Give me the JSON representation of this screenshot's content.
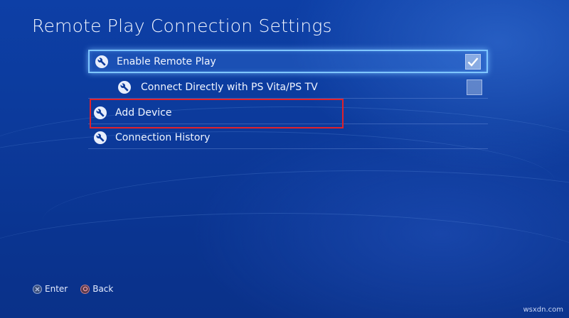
{
  "title": "Remote Play Connection Settings",
  "menu": {
    "items": [
      {
        "label": "Enable Remote Play",
        "icon": "wrench-icon",
        "checkbox": true,
        "checked": true,
        "selected": true
      },
      {
        "label": "Connect Directly with PS Vita/PS TV",
        "icon": "wrench-icon",
        "checkbox": true,
        "checked": false,
        "selected": false
      },
      {
        "label": "Add Device",
        "icon": "wrench-icon",
        "checkbox": false,
        "selected": false
      },
      {
        "label": "Connection History",
        "icon": "wrench-icon",
        "checkbox": false,
        "selected": false
      }
    ]
  },
  "footer": {
    "enter_label": "Enter",
    "back_label": "Back"
  },
  "watermark": "wsxdn.com",
  "colors": {
    "background": "#0c3a9b",
    "selection_border": "#7fc6ff",
    "highlight_box": "#e0212b"
  }
}
